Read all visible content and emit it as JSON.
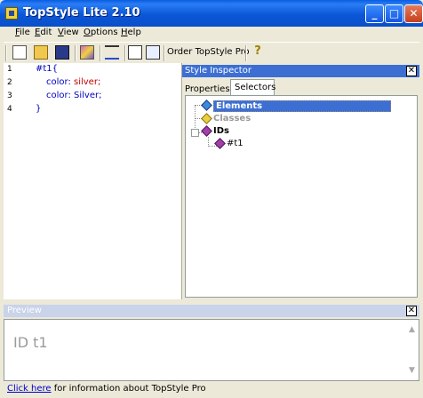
{
  "window": {
    "title": "TopStyle Lite 2.10"
  },
  "menu": {
    "items": [
      "File",
      "Edit",
      "View",
      "Options",
      "Help"
    ]
  },
  "toolbar": {
    "order_label": "Order TopStyle Pro"
  },
  "editor": {
    "line_numbers": [
      "1",
      "2",
      "3",
      "4"
    ],
    "lines": {
      "l1": "#t1{",
      "l2_prop": "color: ",
      "l2_val": "silver;",
      "l3": "color: Silver;",
      "l4": "}"
    }
  },
  "inspector": {
    "title": "Style Inspector",
    "tabs": {
      "properties": "Properties",
      "selectors": "Selectors"
    },
    "tree": {
      "elements": "Elements",
      "classes": "Classes",
      "ids": "IDs",
      "t1": "#t1"
    }
  },
  "preview": {
    "title": "Preview",
    "text": "ID t1"
  },
  "status": {
    "link": "Click here",
    "rest": " for information about TopStyle Pro"
  },
  "colors": {
    "title_blue": "#0a5de0",
    "selection": "#3d6fd3",
    "code_blue": "#0000c0",
    "keyword_red": "#c00000"
  }
}
